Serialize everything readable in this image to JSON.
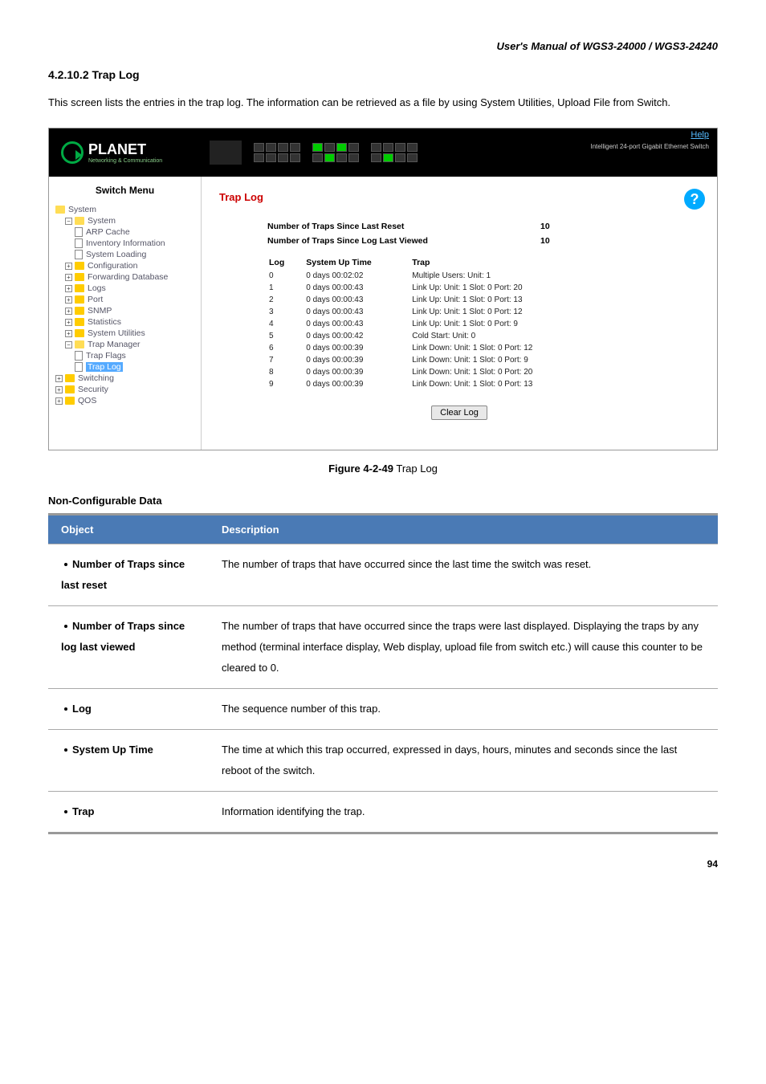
{
  "doc_header": "User's Manual of WGS3-24000 / WGS3-24240",
  "section_number": "4.2.10.2 Trap Log",
  "intro_text": "This screen lists the entries in the trap log. The information can be retrieved as a file by using System Utilities, Upload File from Switch.",
  "figure_caption_bold": "Figure 4-2-49",
  "figure_caption_text": " Trap Log",
  "noncfg_heading": "Non-Configurable Data",
  "page_number": "94",
  "app": {
    "logo_name": "PLANET",
    "logo_sub": "Networking & Communication",
    "help_link": "Help",
    "product_desc": "Intelligent 24-port Gigabit Ethernet Switch",
    "sidebar_title": "Switch Menu",
    "panel_title": "Trap Log",
    "stats": [
      {
        "label": "Number of Traps Since Last Reset",
        "value": "10"
      },
      {
        "label": "Number of Traps Since Log Last Viewed",
        "value": "10"
      }
    ],
    "columns": {
      "log": "Log",
      "time": "System Up Time",
      "trap": "Trap"
    },
    "rows": [
      {
        "log": "0",
        "time": "0 days 00:02:02",
        "trap": "Multiple Users: Unit: 1"
      },
      {
        "log": "1",
        "time": "0 days 00:00:43",
        "trap": "Link Up: Unit: 1 Slot: 0 Port: 20"
      },
      {
        "log": "2",
        "time": "0 days 00:00:43",
        "trap": "Link Up: Unit: 1 Slot: 0 Port: 13"
      },
      {
        "log": "3",
        "time": "0 days 00:00:43",
        "trap": "Link Up: Unit: 1 Slot: 0 Port: 12"
      },
      {
        "log": "4",
        "time": "0 days 00:00:43",
        "trap": "Link Up: Unit: 1 Slot: 0 Port: 9"
      },
      {
        "log": "5",
        "time": "0 days 00:00:42",
        "trap": "Cold Start: Unit: 0"
      },
      {
        "log": "6",
        "time": "0 days 00:00:39",
        "trap": "Link Down: Unit: 1 Slot: 0 Port: 12"
      },
      {
        "log": "7",
        "time": "0 days 00:00:39",
        "trap": "Link Down: Unit: 1 Slot: 0 Port: 9"
      },
      {
        "log": "8",
        "time": "0 days 00:00:39",
        "trap": "Link Down: Unit: 1 Slot: 0 Port: 20"
      },
      {
        "log": "9",
        "time": "0 days 00:00:39",
        "trap": "Link Down: Unit: 1 Slot: 0 Port: 13"
      }
    ],
    "clear_button": "Clear Log",
    "tree": {
      "root": "System",
      "system": "System",
      "arp": "ARP Cache",
      "inv": "Inventory Information",
      "load": "System Loading",
      "config": "Configuration",
      "fwd": "Forwarding Database",
      "logs": "Logs",
      "port": "Port",
      "snmp": "SNMP",
      "stats": "Statistics",
      "util": "System Utilities",
      "trapmgr": "Trap Manager",
      "trapflags": "Trap Flags",
      "traplog": "Trap Log",
      "switching": "Switching",
      "security": "Security",
      "qos": "QOS"
    }
  },
  "def_table": {
    "hdr_obj": "Object",
    "hdr_desc": "Description",
    "rows": [
      {
        "obj": "Number of Traps since last reset",
        "desc": "The number of traps that have occurred since the last time the switch was reset."
      },
      {
        "obj": "Number of Traps since log last viewed",
        "desc": "The number of traps that have occurred since the traps were last displayed. Displaying the traps by any method (terminal interface display, Web display, upload file from switch etc.) will cause this counter to be cleared to 0."
      },
      {
        "obj": "Log",
        "desc": "The sequence number of this trap."
      },
      {
        "obj": "System Up Time",
        "desc": "The time at which this trap occurred, expressed in days, hours, minutes and seconds since the last reboot of the switch."
      },
      {
        "obj": "Trap",
        "desc": "Information identifying the trap."
      }
    ]
  }
}
